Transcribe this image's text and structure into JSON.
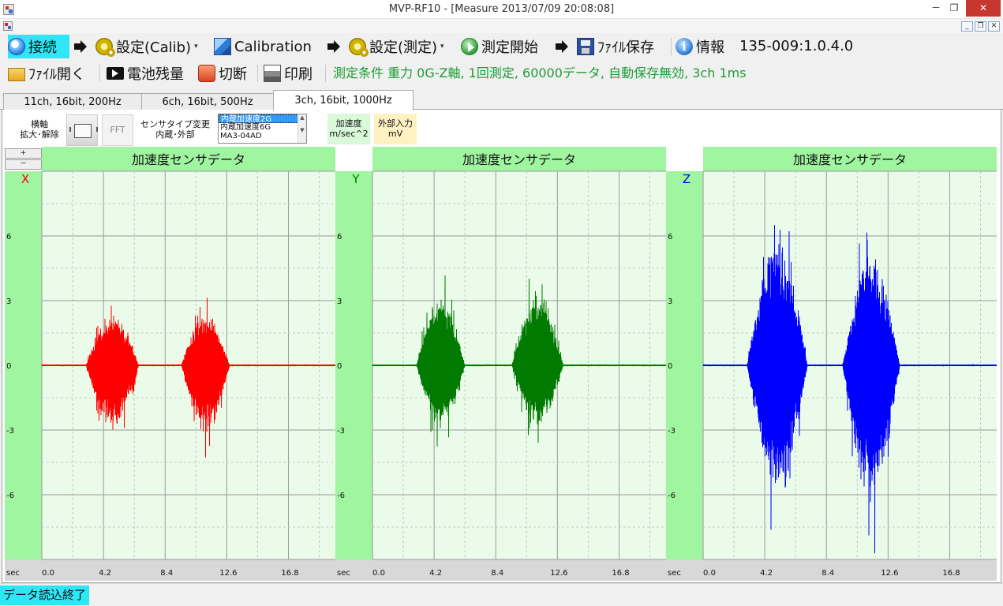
{
  "window": {
    "title": "MVP-RF10  - [Measure 2013/07/09 20:08:08]",
    "controls": {
      "minimize": "－",
      "maximize": "❐",
      "close": "✕"
    }
  },
  "mdi": {
    "controls": {
      "minimize": "_",
      "restore": "❐",
      "close": "✕"
    }
  },
  "toolbar1": {
    "connect": "接続",
    "settings_calib": "設定(Calib)",
    "calibration": "Calibration",
    "settings_measure": "設定(測定)",
    "start_measure": "測定開始",
    "file_save": "ﾌｧｲﾙ保存",
    "info": "情報",
    "version": "135-009:1.0.4.0"
  },
  "toolbar2": {
    "open_file": "ﾌｧｲﾙ開く",
    "battery": "電池残量",
    "disconnect": "切断",
    "print": "印刷",
    "condition": "測定条件 重力 0G-Z軸, 1回測定, 60000データ, 自動保存無効, 3ch 1ms"
  },
  "tabs": [
    {
      "label": "11ch, 16bit, 200Hz"
    },
    {
      "label": "6ch, 16bit, 500Hz"
    },
    {
      "label": "3ch, 16bit, 1000Hz"
    }
  ],
  "controls": {
    "axis_zoom_line1": "横軸",
    "axis_zoom_line2": "拡大･解除",
    "fft": "FFT",
    "sensor_type_line1": "センサタイプ変更",
    "sensor_type_line2": "内蔵･外部",
    "sensor_options": [
      "内蔵加速度2G",
      "内蔵加速度6G",
      "MA3-04AD"
    ],
    "sensor_selected": "内蔵加速度2G",
    "unit_accel_line1": "加速度",
    "unit_accel_line2": "m/sec^2",
    "unit_ext_line1": "外部入力",
    "unit_ext_line2": "mV",
    "step_plus": "+",
    "step_minus": "－"
  },
  "status": {
    "text": "データ読込終了"
  },
  "colors": {
    "x": "#ff0000",
    "y": "#007a00",
    "z": "#0000ff",
    "header": "#a0f5a0",
    "plot_bg": "#eafbea"
  },
  "chart_data": [
    {
      "type": "line",
      "title": "加速度センサデータ",
      "channel": "X",
      "ylabel": "加速度 m/sec^2",
      "xlabel": "sec",
      "x_ticks": [
        "0.0",
        "4.2",
        "8.4",
        "12.6",
        "16.8"
      ],
      "y_ticks": [
        "6",
        "3",
        "0",
        "-3",
        "-6"
      ],
      "xlim": [
        0,
        20
      ],
      "ylim": [
        -9,
        9
      ],
      "grid": true,
      "bursts": [
        {
          "start": 3.0,
          "end": 6.6,
          "peak_pos": 3.3,
          "peak_neg": -4.2
        },
        {
          "start": 9.5,
          "end": 12.8,
          "peak_pos": 3.3,
          "peak_neg": -4.4
        }
      ],
      "baseline": 0
    },
    {
      "type": "line",
      "title": "加速度センサデータ",
      "channel": "Y",
      "ylabel": "加速度 m/sec^2",
      "xlabel": "sec",
      "x_ticks": [
        "0.0",
        "4.2",
        "8.4",
        "12.6",
        "16.8"
      ],
      "y_ticks": [
        "6",
        "3",
        "0",
        "-3",
        "-6"
      ],
      "xlim": [
        0,
        20
      ],
      "ylim": [
        -9,
        9
      ],
      "grid": true,
      "bursts": [
        {
          "start": 3.0,
          "end": 6.3,
          "peak_pos": 4.5,
          "peak_neg": -4.0
        },
        {
          "start": 9.5,
          "end": 13.0,
          "peak_pos": 4.7,
          "peak_neg": -4.0
        }
      ],
      "baseline": 0
    },
    {
      "type": "line",
      "title": "加速度センサデータ",
      "channel": "Z",
      "ylabel": "加速度 m/sec^2",
      "xlabel": "sec",
      "x_ticks": [
        "0.0",
        "4.2",
        "8.4",
        "12.6",
        "16.8"
      ],
      "y_ticks": [
        "6",
        "3",
        "0",
        "-3",
        "-6"
      ],
      "xlim": [
        0,
        20
      ],
      "ylim": [
        -9,
        9
      ],
      "grid": true,
      "bursts": [
        {
          "start": 3.0,
          "end": 7.1,
          "peak_pos": 8.1,
          "peak_neg": -8.2
        },
        {
          "start": 9.5,
          "end": 13.4,
          "peak_pos": 7.2,
          "peak_neg": -8.9
        }
      ],
      "baseline": 0
    }
  ]
}
